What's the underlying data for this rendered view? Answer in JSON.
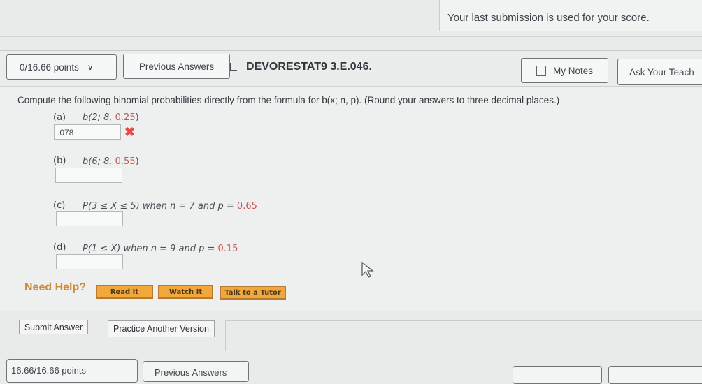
{
  "notice": "Your last submission is used for your score.",
  "header": {
    "points": "0/16.66 points",
    "previous_answers": "Previous Answers",
    "problem_code": "DEVORESTAT9 3.E.046.",
    "my_notes": "My Notes",
    "ask_teacher": "Ask Your Teach"
  },
  "question": "Compute the following binomial probabilities directly from the formula for b(x; n, p). (Round your answers to three decimal places.)",
  "parts": [
    {
      "label": "(a)",
      "expr_main": "b(2; 8, ",
      "expr_red": "0.25",
      "expr_end": ")",
      "answer": ".078",
      "status": "incorrect"
    },
    {
      "label": "(b)",
      "expr_main": "b(6; 8, ",
      "expr_red": "0.55",
      "expr_end": ")",
      "answer": ""
    },
    {
      "label": "(c)",
      "expr_main": "P(3 ≤ X ≤ 5)  when n = 7 and p = ",
      "expr_red": "0.65",
      "expr_end": "",
      "answer": ""
    },
    {
      "label": "(d)",
      "expr_main": "P(1 ≤ X)  when n = 9 and p = ",
      "expr_red": "0.15",
      "expr_end": "",
      "answer": ""
    }
  ],
  "help": {
    "title": "Need Help?",
    "read_it": "Read It",
    "watch_it": "Watch It",
    "talk_tutor": "Talk to a Tutor"
  },
  "actions": {
    "submit": "Submit Answer",
    "practice": "Practice Another Version"
  },
  "next": {
    "points": "16.66/16.66 points",
    "previous": "Previous Answers"
  },
  "colors": {
    "accent_red": "#c05a57",
    "help_orange": "#f2a73a",
    "error_x": "#e8494c"
  }
}
